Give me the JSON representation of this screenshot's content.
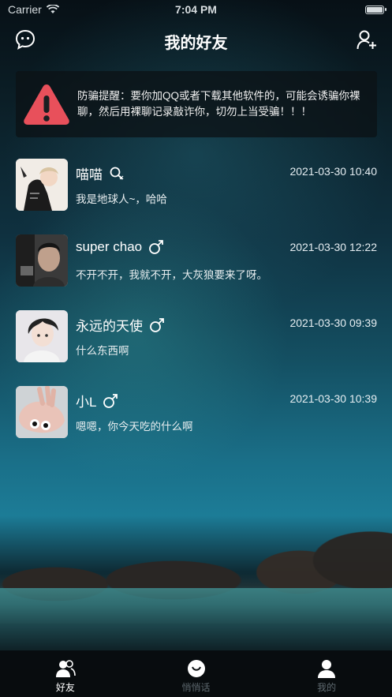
{
  "status_bar": {
    "carrier": "Carrier",
    "time": "7:04 PM"
  },
  "nav": {
    "title": "我的好友",
    "left_icon": "chat-bubble-icon",
    "right_icon": "add-user-icon"
  },
  "warning": {
    "icon": "alert-triangle-icon",
    "color": "#e8505b",
    "text": "防骗提醒：要你加QQ或者下载其他软件的，可能会诱骗你裸聊，然后用裸聊记录敲诈你，切勿上当受骗！！！"
  },
  "friends": [
    {
      "name": "喵喵",
      "gender": "unknown",
      "gender_icon": "search-person-icon",
      "time": "2021-03-30 10:40",
      "message": "我是地球人~，哈哈"
    },
    {
      "name": "super chao",
      "gender": "male",
      "gender_icon": "male-symbol-icon",
      "time": "2021-03-30 12:22",
      "message": "不开不开，我就不开，大灰狼要来了呀。"
    },
    {
      "name": "永远的天使",
      "gender": "male",
      "gender_icon": "male-symbol-icon",
      "time": "2021-03-30 09:39",
      "message": "什么东西啊"
    },
    {
      "name": "小L",
      "gender": "male",
      "gender_icon": "male-symbol-icon",
      "time": "2021-03-30 10:39",
      "message": "嗯嗯，你今天吃的什么啊"
    }
  ],
  "tabs": [
    {
      "label": "好友",
      "icon": "friends-icon",
      "active": true
    },
    {
      "label": "悄悄话",
      "icon": "whisper-icon",
      "active": false
    },
    {
      "label": "我的",
      "icon": "profile-icon",
      "active": false
    }
  ]
}
